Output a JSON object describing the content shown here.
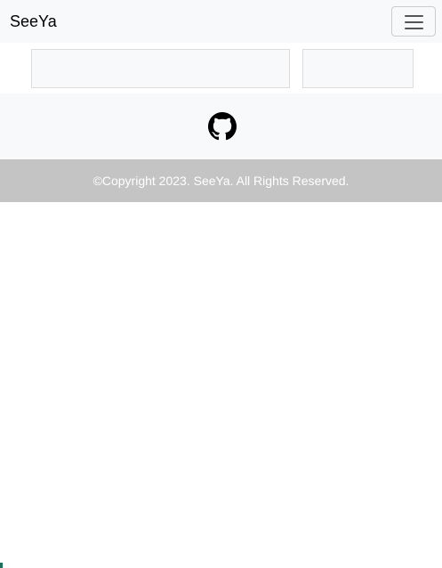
{
  "navbar": {
    "brand": "SeeYa",
    "toggler_icon": "hamburger-menu-icon"
  },
  "social": {
    "github_icon": "github-icon"
  },
  "footer": {
    "copyright": "©Copyright 2023. SeeYa. All Rights Reserved."
  },
  "colors": {
    "navbar_bg": "#f8f9fa",
    "footer_bg": "#c4c4c4",
    "footer_text": "#ffffff"
  }
}
